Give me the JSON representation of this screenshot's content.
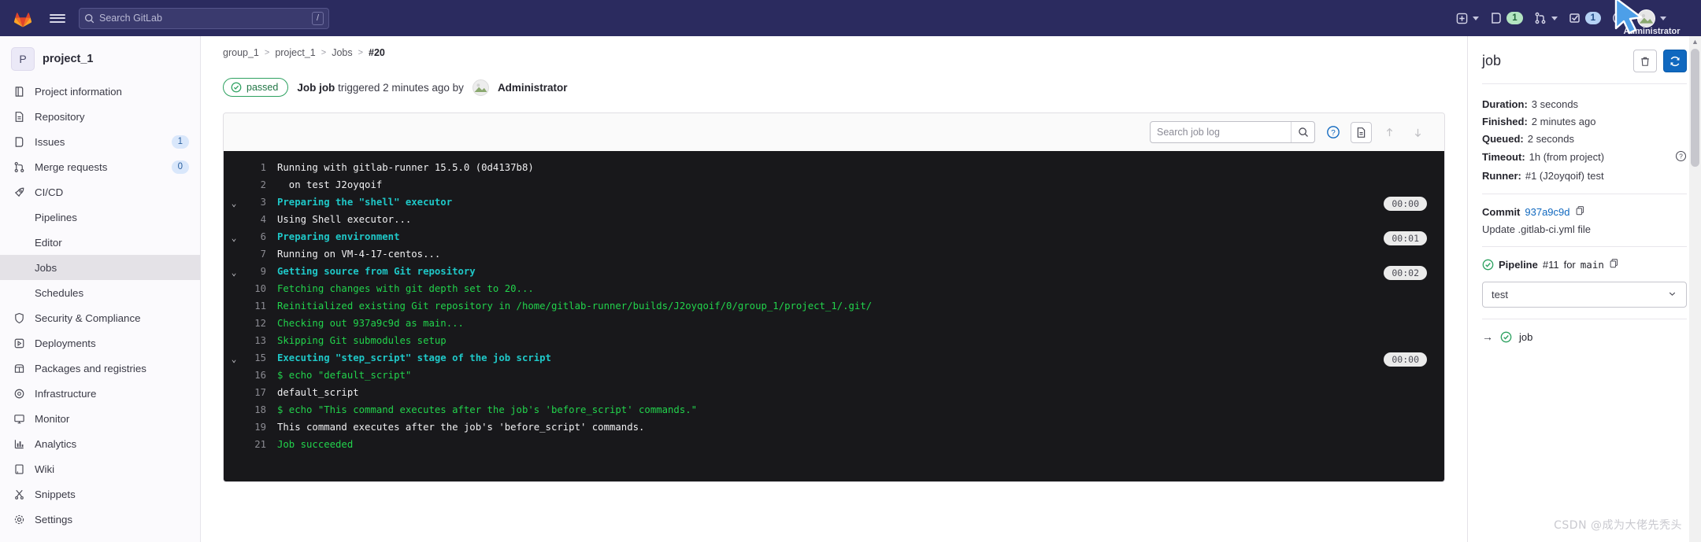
{
  "navbar": {
    "logo_icon": "gitlab-logo-icon",
    "hamburger_icon": "hamburger-menu-icon",
    "search": {
      "placeholder": "Search GitLab",
      "value": "",
      "shortcut": "/"
    },
    "items": [
      {
        "name": "create-new",
        "icon": "plus-square-icon",
        "badge": "",
        "has_chevron": true
      },
      {
        "name": "issues",
        "icon": "issues-icon",
        "badge": "1",
        "badge_style": "green",
        "has_chevron": false
      },
      {
        "name": "merge-requests",
        "icon": "merge-request-icon",
        "badge": "",
        "has_chevron": true
      },
      {
        "name": "todos",
        "icon": "todo-checkbox-icon",
        "badge": "1",
        "badge_style": "blue",
        "has_chevron": false
      },
      {
        "name": "help",
        "icon": "question-circle-icon",
        "badge": "",
        "has_chevron": false
      }
    ],
    "user": {
      "label": "Administrator",
      "avatar_icon": "user-avatar-icon"
    }
  },
  "sidebar": {
    "project": {
      "initial": "P",
      "name": "project_1"
    },
    "items": [
      {
        "label": "Project information",
        "icon": "book-icon",
        "badge": "",
        "sub": false,
        "active": false
      },
      {
        "label": "Repository",
        "icon": "file-icon",
        "badge": "",
        "sub": false,
        "active": false
      },
      {
        "label": "Issues",
        "icon": "issues-icon",
        "badge": "1",
        "sub": false,
        "active": false
      },
      {
        "label": "Merge requests",
        "icon": "merge-request-icon",
        "badge": "0",
        "sub": false,
        "active": false
      },
      {
        "label": "CI/CD",
        "icon": "rocket-icon",
        "badge": "",
        "sub": false,
        "active": false
      },
      {
        "label": "Pipelines",
        "icon": "",
        "badge": "",
        "sub": true,
        "active": false
      },
      {
        "label": "Editor",
        "icon": "",
        "badge": "",
        "sub": true,
        "active": false
      },
      {
        "label": "Jobs",
        "icon": "",
        "badge": "",
        "sub": true,
        "active": true
      },
      {
        "label": "Schedules",
        "icon": "",
        "badge": "",
        "sub": true,
        "active": false
      },
      {
        "label": "Security & Compliance",
        "icon": "shield-icon",
        "badge": "",
        "sub": false,
        "active": false
      },
      {
        "label": "Deployments",
        "icon": "deployments-icon",
        "badge": "",
        "sub": false,
        "active": false
      },
      {
        "label": "Packages and registries",
        "icon": "package-icon",
        "badge": "",
        "sub": false,
        "active": false
      },
      {
        "label": "Infrastructure",
        "icon": "cloud-gear-icon",
        "badge": "",
        "sub": false,
        "active": false
      },
      {
        "label": "Monitor",
        "icon": "monitor-icon",
        "badge": "",
        "sub": false,
        "active": false
      },
      {
        "label": "Analytics",
        "icon": "chart-icon",
        "badge": "",
        "sub": false,
        "active": false
      },
      {
        "label": "Wiki",
        "icon": "book-open-icon",
        "badge": "",
        "sub": false,
        "active": false
      },
      {
        "label": "Snippets",
        "icon": "scissors-icon",
        "badge": "",
        "sub": false,
        "active": false
      },
      {
        "label": "Settings",
        "icon": "gear-icon",
        "badge": "",
        "sub": false,
        "active": false
      }
    ]
  },
  "breadcrumb": {
    "group": "group_1",
    "project": "project_1",
    "section": "Jobs",
    "current": "#20",
    "separator": ">"
  },
  "job_header": {
    "status": "passed",
    "status_icon": "check-circle-icon",
    "title_bold": "Job job",
    "triggered_text": "triggered 2 minutes ago by",
    "user": "Administrator"
  },
  "log_toolbar": {
    "search_placeholder": "Search job log",
    "search_value": "",
    "search_icon": "search-icon",
    "help_icon": "question-circle-icon",
    "raw_icon": "document-raw-icon",
    "scroll_top_icon": "arrow-up-icon",
    "scroll_bottom_icon": "arrow-down-icon"
  },
  "log": {
    "lines": [
      {
        "num": "1",
        "text": "Running with gitlab-runner 15.5.0 (0d4137b8)",
        "color": "plain",
        "chevron": false,
        "time": ""
      },
      {
        "num": "2",
        "text": "  on test J2oyqoif",
        "color": "plain",
        "chevron": false,
        "time": ""
      },
      {
        "num": "3",
        "text": "Preparing the \"shell\" executor",
        "color": "cyan",
        "chevron": true,
        "time": "00:00"
      },
      {
        "num": "4",
        "text": "Using Shell executor...",
        "color": "plain",
        "chevron": false,
        "time": ""
      },
      {
        "num": "6",
        "text": "Preparing environment",
        "color": "cyan",
        "chevron": true,
        "time": "00:01"
      },
      {
        "num": "7",
        "text": "Running on VM-4-17-centos...",
        "color": "plain",
        "chevron": false,
        "time": ""
      },
      {
        "num": "9",
        "text": "Getting source from Git repository",
        "color": "cyan",
        "chevron": true,
        "time": "00:02"
      },
      {
        "num": "10",
        "text": "Fetching changes with git depth set to 20...",
        "color": "green",
        "chevron": false,
        "time": ""
      },
      {
        "num": "11",
        "text": "Reinitialized existing Git repository in /home/gitlab-runner/builds/J2oyqoif/0/group_1/project_1/.git/",
        "color": "green",
        "chevron": false,
        "time": ""
      },
      {
        "num": "12",
        "text": "Checking out 937a9c9d as main...",
        "color": "green",
        "chevron": false,
        "time": ""
      },
      {
        "num": "13",
        "text": "Skipping Git submodules setup",
        "color": "green",
        "chevron": false,
        "time": ""
      },
      {
        "num": "15",
        "text": "Executing \"step_script\" stage of the job script",
        "color": "cyan",
        "chevron": true,
        "time": "00:00"
      },
      {
        "num": "16",
        "text": "$ echo \"default_script\"",
        "color": "green",
        "chevron": false,
        "time": ""
      },
      {
        "num": "17",
        "text": "default_script",
        "color": "plain",
        "chevron": false,
        "time": ""
      },
      {
        "num": "18",
        "text": "$ echo \"This command executes after the job's 'before_script' commands.\"",
        "color": "green",
        "chevron": false,
        "time": ""
      },
      {
        "num": "19",
        "text": "This command executes after the job's 'before_script' commands.",
        "color": "plain",
        "chevron": false,
        "time": ""
      },
      {
        "num": "21",
        "text": "Job succeeded",
        "color": "green",
        "chevron": false,
        "time": ""
      }
    ]
  },
  "right_panel": {
    "title": "job",
    "erase_icon": "trash-icon",
    "retry_icon": "retry-refresh-icon",
    "details": [
      {
        "label": "Duration:",
        "value": "3 seconds",
        "help": false
      },
      {
        "label": "Finished:",
        "value": "2 minutes ago",
        "help": false
      },
      {
        "label": "Queued:",
        "value": "2 seconds",
        "help": false
      },
      {
        "label": "Timeout:",
        "value": "1h (from project)",
        "help": true
      },
      {
        "label": "Runner:",
        "value": "#1 (J2oyqoif) test",
        "help": false
      }
    ],
    "commit": {
      "label": "Commit",
      "sha": "937a9c9d",
      "copy_icon": "copy-icon",
      "message": "Update .gitlab-ci.yml file"
    },
    "pipeline": {
      "status_icon": "check-circle-icon",
      "label": "Pipeline",
      "number": "#11",
      "for_text": "for",
      "ref": "main",
      "copy_icon": "copy-icon"
    },
    "stage_select": {
      "value": "test",
      "chevron_icon": "chevron-down-icon"
    },
    "jobs": [
      {
        "arrow": "→",
        "status_icon": "check-circle-icon",
        "label": "job"
      }
    ]
  },
  "watermark": {
    "text": "CSDN @成为大佬先秃头"
  },
  "colors": {
    "navbar_bg": "#2b2b5f",
    "accent_blue": "#1068bf",
    "success_green": "#2da160",
    "log_bg": "#18181b",
    "log_green": "#22d34c",
    "log_cyan": "#1fc8c8"
  }
}
